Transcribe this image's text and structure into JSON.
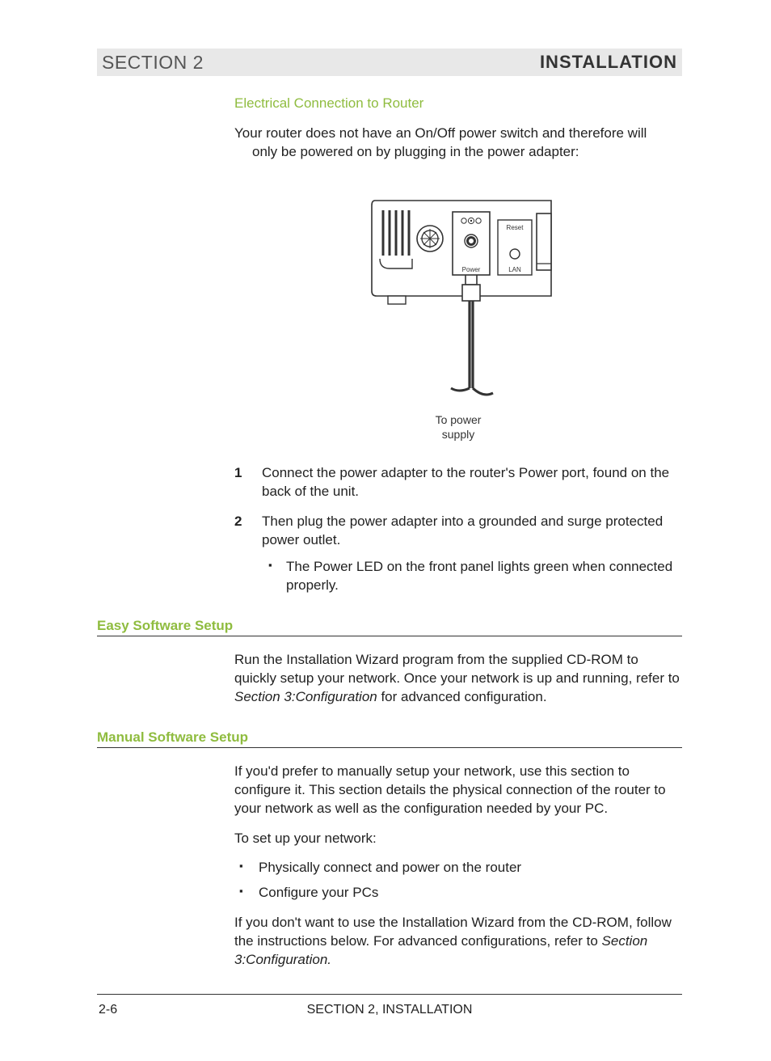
{
  "header": {
    "section_label": "SECTION 2",
    "title": "INSTALLATION"
  },
  "heading_electrical": "Electrical Connection to Router",
  "intro_para_line1": "Your router does not have an On/Off power switch and therefore will",
  "intro_para_line2": "only be powered on by plugging in the power adapter:",
  "figure": {
    "reset_label": "Reset",
    "power_label": "Power",
    "lan_label": "LAN",
    "caption_line1": "To power",
    "caption_line2": "supply"
  },
  "steps": [
    "Connect the power adapter to the router's Power port, found on the back of the unit.",
    "Then plug the power adapter into a grounded and surge protected power outlet."
  ],
  "step2_bullets": [
    "The Power LED on the front panel lights green when connected properly."
  ],
  "easy_setup": {
    "heading": "Easy Software Setup",
    "para_pre": "Run the Installation Wizard program from the supplied CD-ROM to quickly setup your network. Once your network is up and running, refer to ",
    "para_italic": "Section 3:Configuration",
    "para_post": " for advanced configuration."
  },
  "manual_setup": {
    "heading": "Manual Software Setup",
    "para1": "If you'd prefer to manually setup your network, use this section to configure it. This section details the physical connection of the router to your network as well as the configuration needed by your PC.",
    "para2": "To set up your network:",
    "bullets": [
      "Physically connect and power on the router",
      "Configure your PCs"
    ],
    "para3_pre": "If you don't want to use the Installation Wizard from the CD-ROM, follow the instructions below. For advanced configurations, refer to ",
    "para3_italic": "Section 3:Configuration.",
    "para3_post": ""
  },
  "footer": {
    "page": "2-6",
    "center": "SECTION 2, INSTALLATION"
  }
}
